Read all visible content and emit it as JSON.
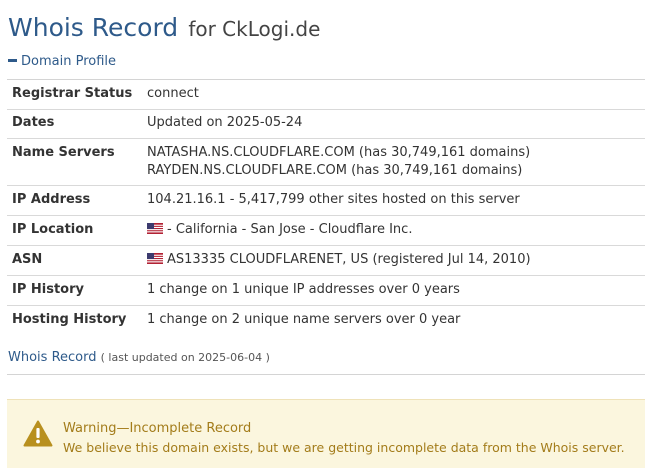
{
  "header": {
    "title": "Whois Record",
    "subtitle": "for CkLogi.de"
  },
  "domain_profile": {
    "section_label": "Domain Profile",
    "toggle_icon": "minus-icon",
    "rows": [
      {
        "label": "Registrar Status",
        "value": "connect"
      },
      {
        "label": "Dates",
        "value": "Updated on 2025-05-24"
      },
      {
        "label": "Name Servers",
        "lines": [
          "NATASHA.NS.CLOUDFLARE.COM (has 30,749,161 domains)",
          "RAYDEN.NS.CLOUDFLARE.COM (has 30,749,161 domains)"
        ]
      },
      {
        "label": "IP Address",
        "value": "104.21.16.1 - 5,417,799 other sites hosted on this server"
      },
      {
        "label": "IP Location",
        "value": "- California - San Jose - Cloudflare Inc.",
        "flag": "us-flag-icon"
      },
      {
        "label": "ASN",
        "value": "AS13335 CLOUDFLARENET, US (registered Jul 14, 2010)",
        "flag": "us-flag-icon"
      },
      {
        "label": "IP History",
        "value": "1 change on 1 unique IP addresses over 0 years"
      },
      {
        "label": "Hosting History",
        "value": "1 change on 2 unique name servers over 0 year"
      }
    ]
  },
  "whois_record": {
    "label": "Whois Record",
    "updated_text": "( last updated on 2025-06-04 )"
  },
  "warning": {
    "icon": "warning-triangle-icon",
    "title": "Warning—Incomplete Record",
    "message": "We believe this domain exists, but we are getting incomplete data from the Whois server."
  },
  "colors": {
    "link_blue": "#2e5a8a",
    "warning_text": "#a37c1a",
    "warning_bg": "#fbf6de",
    "warning_icon": "#b8901f"
  }
}
